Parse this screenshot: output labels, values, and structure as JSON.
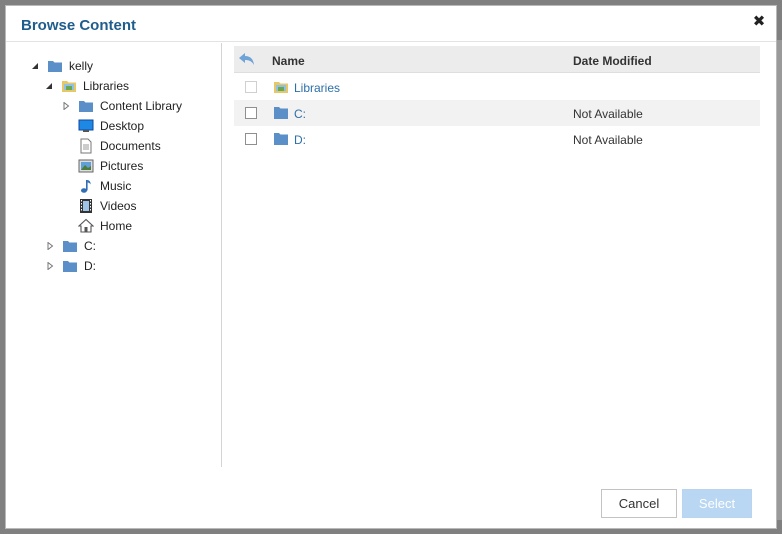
{
  "dialog": {
    "title": "Browse Content",
    "close_icon": "close-icon",
    "close_glyph": "✖"
  },
  "tree": {
    "root": {
      "label": "kelly",
      "icon": "folder-icon",
      "expanded": true
    },
    "libraries": {
      "label": "Libraries",
      "icon": "libraries-icon",
      "expanded": true
    },
    "library_items": [
      {
        "label": "Content Library",
        "icon": "folder-icon",
        "expandable": true
      },
      {
        "label": "Desktop",
        "icon": "desktop-icon",
        "expandable": false
      },
      {
        "label": "Documents",
        "icon": "documents-icon",
        "expandable": false
      },
      {
        "label": "Pictures",
        "icon": "pictures-icon",
        "expandable": false
      },
      {
        "label": "Music",
        "icon": "music-icon",
        "expandable": false
      },
      {
        "label": "Videos",
        "icon": "videos-icon",
        "expandable": false
      },
      {
        "label": "Home",
        "icon": "home-icon",
        "expandable": false
      }
    ],
    "drives": [
      {
        "label": "C:",
        "icon": "folder-icon",
        "expandable": true
      },
      {
        "label": "D:",
        "icon": "folder-icon",
        "expandable": true
      }
    ]
  },
  "list": {
    "back_icon": "back-arrow-icon",
    "columns": {
      "name": "Name",
      "date": "Date Modified"
    },
    "rows": [
      {
        "name": "Libraries",
        "date": "",
        "icon": "libraries-icon",
        "checkbox_enabled": false
      },
      {
        "name": "C:",
        "date": "Not Available",
        "icon": "folder-icon",
        "checkbox_enabled": true
      },
      {
        "name": "D:",
        "date": "Not Available",
        "icon": "folder-icon",
        "checkbox_enabled": true
      }
    ]
  },
  "footer": {
    "cancel_label": "Cancel",
    "select_label": "Select",
    "select_enabled": false
  },
  "colors": {
    "title": "#1f5d8c",
    "folder": "#5b8fc7",
    "link": "#2d6fa8",
    "select_disabled": "#b9d6f2"
  }
}
